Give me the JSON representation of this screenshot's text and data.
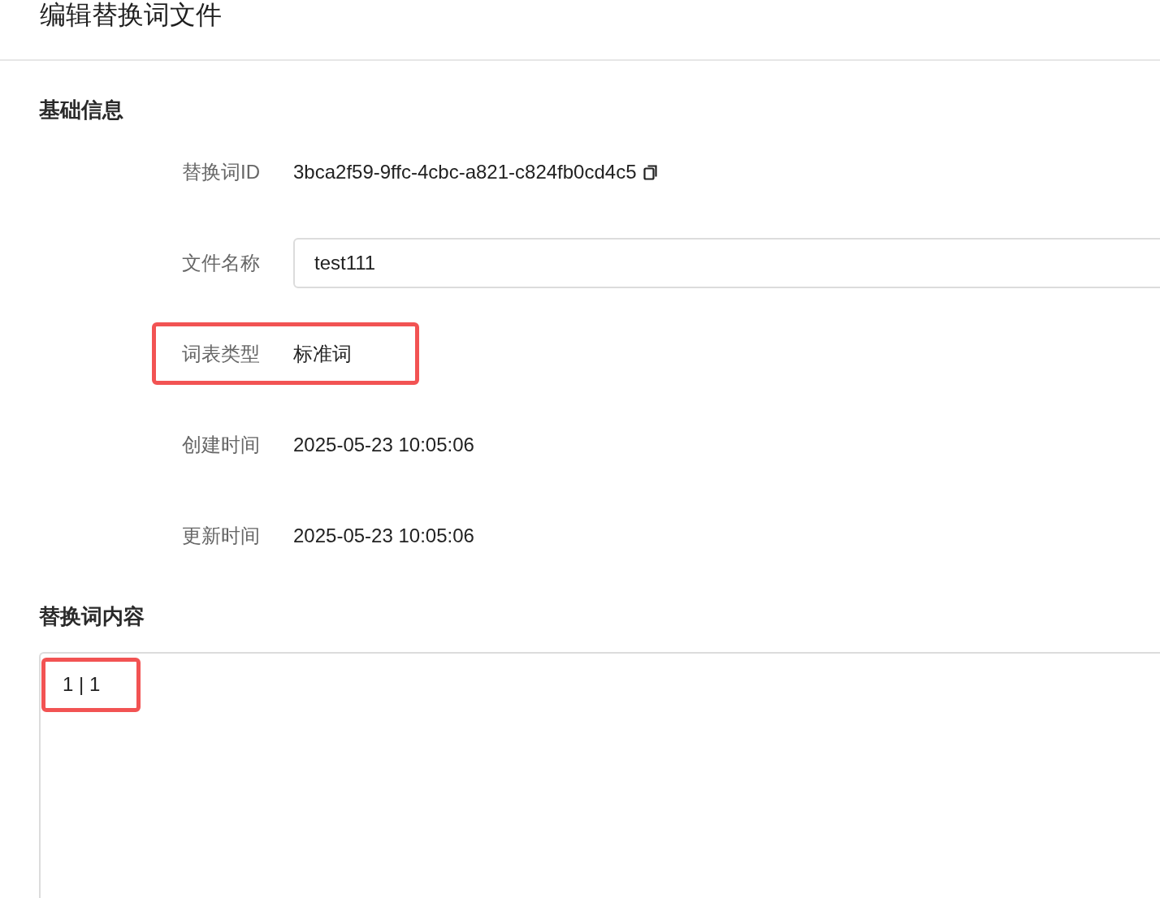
{
  "page": {
    "title": "编辑替换词文件"
  },
  "basic_info": {
    "heading": "基础信息",
    "fields": [
      {
        "kind": "text",
        "label": "替换词ID",
        "value": "3bca2f59-9ffc-4cbc-a821-c824fb0cd4c5",
        "copyable": true,
        "highlighted": false
      },
      {
        "kind": "input",
        "label": "文件名称",
        "value": "test111",
        "copyable": false,
        "highlighted": false
      },
      {
        "kind": "text",
        "label": "词表类型",
        "value": "标准词",
        "copyable": false,
        "highlighted": true
      },
      {
        "kind": "text",
        "label": "创建时间",
        "value": "2025-05-23 10:05:06",
        "copyable": false,
        "highlighted": false
      },
      {
        "kind": "text",
        "label": "更新时间",
        "value": "2025-05-23 10:05:06",
        "copyable": false,
        "highlighted": false
      }
    ]
  },
  "content": {
    "heading": "替换词内容",
    "value": "1 | 1",
    "highlighted": true
  }
}
